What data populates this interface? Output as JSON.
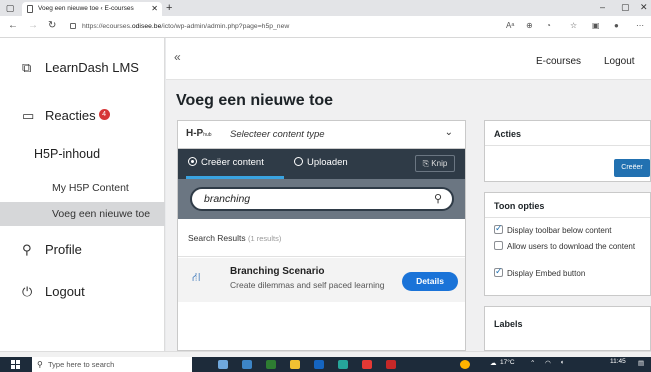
{
  "browser": {
    "tab_title": "Voeg een nieuwe toe ‹ E-courses",
    "url_host": "https://ecourses.",
    "url_domain": "odisee.be",
    "url_path": "/icto/wp-admin/admin.php?page=h5p_new"
  },
  "sidebar": {
    "brand": "LearnDash LMS",
    "reacties": {
      "label": "Reacties",
      "badge": "4"
    },
    "h5p": "H5P-inhoud",
    "sub_items": [
      "My H5P Content",
      "Voeg een nieuwe toe"
    ],
    "profile": "Profile",
    "logout": "Logout"
  },
  "topbar": {
    "collapse": "«",
    "site": "E-courses",
    "logout": "Logout"
  },
  "page": {
    "title": "Voeg een nieuwe toe"
  },
  "editor": {
    "logo": "H-P",
    "logo_hub": "hub",
    "selector_text": "Selecteer content type",
    "mode_create": "Creëer content",
    "mode_upload": "Uploaden",
    "knip": "Knip",
    "search_value": "branching",
    "results_label": "Search Results",
    "results_count": "(1 results)",
    "result": {
      "title": "Branching Scenario",
      "description": "Create dilemmas and self paced learning",
      "button": "Details"
    }
  },
  "panels": {
    "acties": {
      "title": "Acties",
      "button": "Creëer"
    },
    "toon_opties": {
      "title": "Toon opties",
      "options": [
        {
          "label": "Display toolbar below content",
          "checked": true
        },
        {
          "label": "Allow users to download the content",
          "checked": false
        },
        {
          "label": "Display Embed button",
          "checked": true
        }
      ]
    },
    "labels": {
      "title": "Labels"
    }
  },
  "taskbar": {
    "search_placeholder": "Type here to search",
    "weather": "17°C",
    "time": "11:45"
  },
  "colors": {
    "accent": "#2271b1",
    "badge": "#d63638",
    "hub_dark": "#2f3b47",
    "hub_search": "#6b7682",
    "details": "#1a73d8"
  }
}
